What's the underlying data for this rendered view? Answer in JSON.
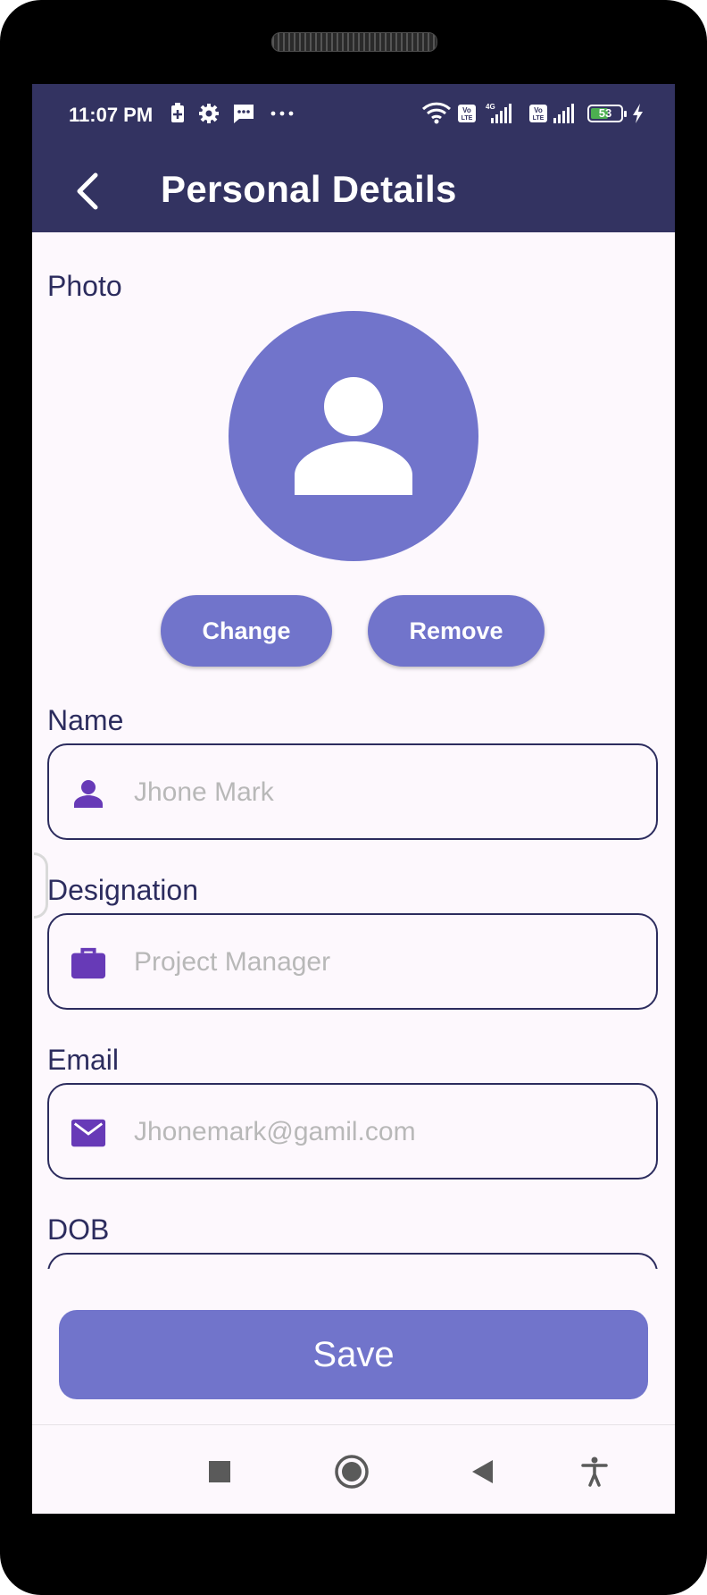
{
  "status_bar": {
    "time": "11:07 PM",
    "battery": "53",
    "icons": [
      "battery-saver-icon",
      "settings-icon",
      "message-icon",
      "more-dots-icon",
      "wifi-icon",
      "volte-icon",
      "signal-4g-icon",
      "volte-icon",
      "signal-icon",
      "battery-icon",
      "charging-icon"
    ]
  },
  "app_bar": {
    "title": "Personal Details",
    "back_icon": "back-arrow-icon"
  },
  "photo": {
    "label": "Photo",
    "change_label": "Change",
    "remove_label": "Remove"
  },
  "fields": {
    "name": {
      "label": "Name",
      "placeholder": "Jhone Mark",
      "icon": "person-icon"
    },
    "designation": {
      "label": "Designation",
      "placeholder": "Project Manager",
      "icon": "briefcase-icon"
    },
    "email": {
      "label": "Email",
      "placeholder": "Jhonemark@gamil.com",
      "icon": "mail-icon"
    },
    "dob": {
      "label": "DOB"
    }
  },
  "save_label": "Save",
  "colors": {
    "app_bar": "#333361",
    "accent": "#7174cb",
    "icon_purple": "#673ab7",
    "background": "#fdf8fd",
    "placeholder": "#b8b8b8"
  }
}
